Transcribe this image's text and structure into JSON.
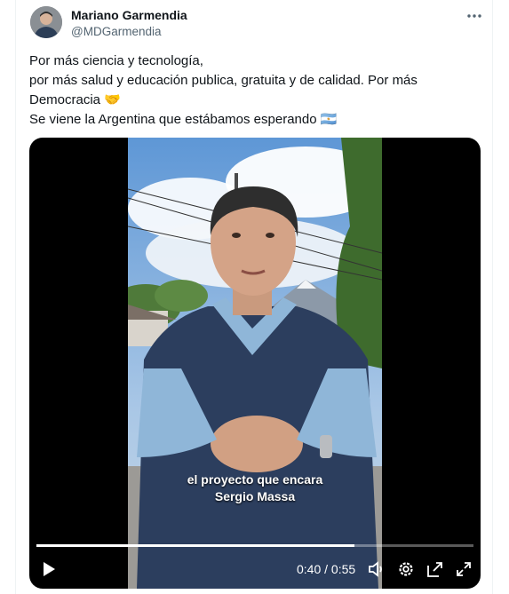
{
  "tweet": {
    "author_name": "Mariano Garmendia",
    "author_handle": "@MDGarmendia",
    "lines": [
      "Por más ciencia y tecnología,",
      "por más salud y educación publica, gratuita y de calidad. Por más",
      "Democracia 🤝",
      "Se viene la Argentina que estábamos esperando 🇦🇷"
    ]
  },
  "video": {
    "caption_line1": "el proyecto que encara",
    "caption_line2": "Sergio Massa",
    "current_time": "0:40",
    "duration": "0:55",
    "time_display": "0:40 / 0:55",
    "progress_fraction": 0.727
  },
  "colors": {
    "accent": "#1d9bf0",
    "text": "#0f1419",
    "muted": "#536471"
  },
  "icons": [
    "more-icon",
    "play-icon",
    "volume-icon",
    "settings-icon",
    "pip-icon",
    "fullscreen-icon"
  ]
}
